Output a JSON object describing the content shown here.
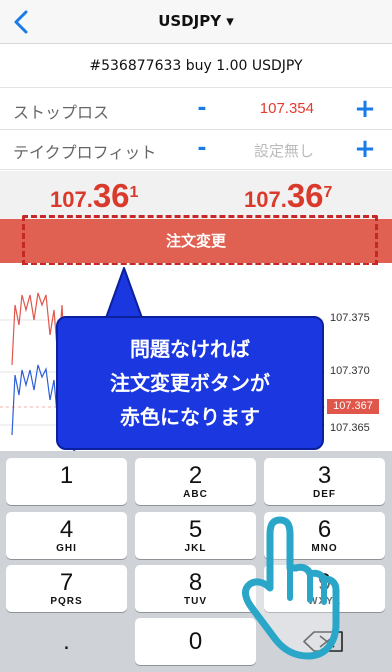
{
  "header": {
    "title": "USDJPY ▾",
    "back_icon": "chevron-left-icon"
  },
  "order": {
    "summary": "#536877633 buy 1.00 USDJPY"
  },
  "stop_loss": {
    "label": "ストップロス",
    "minus": "-",
    "value": "107.354",
    "plus": "+"
  },
  "take_profit": {
    "label": "テイクプロフィット",
    "minus": "-",
    "value": "設定無し",
    "plus": "+"
  },
  "quote": {
    "bid": {
      "prefix": "107.",
      "big": "36",
      "sup": "1"
    },
    "ask": {
      "prefix": "107.",
      "big": "36",
      "sup": "7"
    }
  },
  "order_button": {
    "label": "注文変更"
  },
  "chart_axis": {
    "labels": [
      "107.375",
      "107.370",
      "107.365"
    ],
    "current": "107.367"
  },
  "callout": {
    "lines": [
      "問題なければ",
      "注文変更ボタンが",
      "赤色になります"
    ]
  },
  "keypad": {
    "keys": [
      {
        "digit": "1",
        "letters": ""
      },
      {
        "digit": "2",
        "letters": "ABC"
      },
      {
        "digit": "3",
        "letters": "DEF"
      },
      {
        "digit": "4",
        "letters": "GHI"
      },
      {
        "digit": "5",
        "letters": "JKL"
      },
      {
        "digit": "6",
        "letters": "MNO"
      },
      {
        "digit": "7",
        "letters": "PQRS"
      },
      {
        "digit": "8",
        "letters": "TUV"
      },
      {
        "digit": "9",
        "letters": "WXYZ"
      }
    ],
    "dot": ".",
    "zero": "0",
    "delete_icon": "backspace-icon"
  },
  "colors": {
    "accent": "#1a7ae8",
    "price_red": "#d93a2b",
    "order_button": "#e06052",
    "callout_blue": "#1a37e0"
  }
}
